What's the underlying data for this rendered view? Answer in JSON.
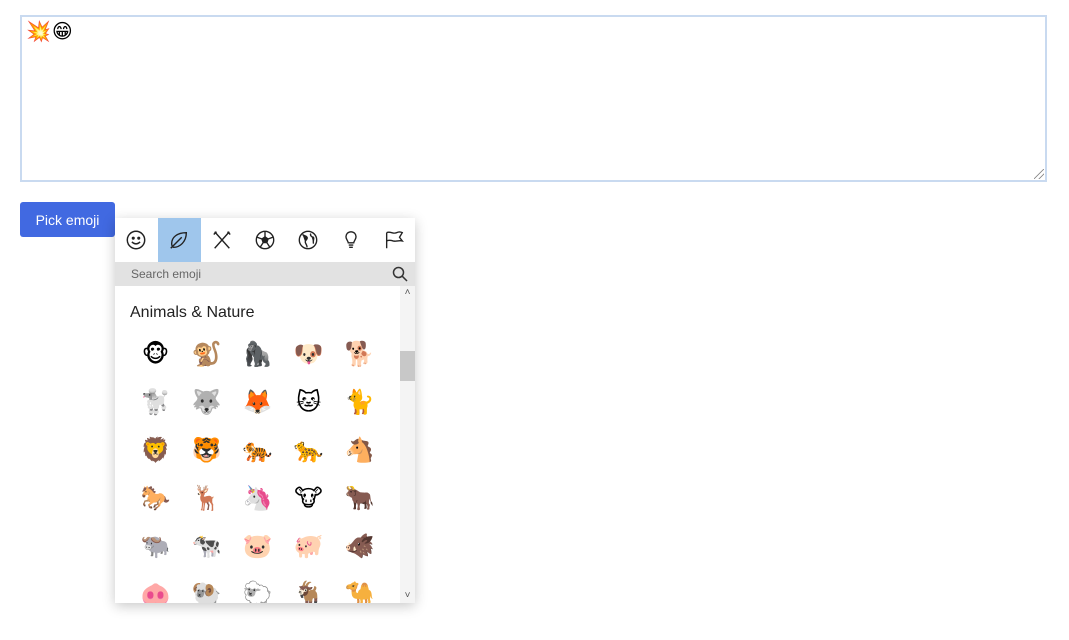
{
  "editor": {
    "content": "💥😁"
  },
  "button": {
    "pick_label": "Pick emoji"
  },
  "picker": {
    "tabs": [
      {
        "icon": "smiley-icon",
        "active": false
      },
      {
        "icon": "leaf-icon",
        "active": true
      },
      {
        "icon": "utensils-icon",
        "active": false
      },
      {
        "icon": "soccer-ball-icon",
        "active": false
      },
      {
        "icon": "globe-icon",
        "active": false
      },
      {
        "icon": "lightbulb-icon",
        "active": false
      },
      {
        "icon": "flag-icon",
        "active": false
      }
    ],
    "search": {
      "placeholder": "Search emoji"
    },
    "category": {
      "title": "Animals & Nature"
    },
    "emojis": [
      "🐵",
      "🐒",
      "🦍",
      "🐶",
      "🐕",
      "🐩",
      "🐺",
      "🦊",
      "🐱",
      "🐈",
      "🦁",
      "🐯",
      "🐅",
      "🐆",
      "🐴",
      "🐎",
      "🦌",
      "🦄",
      "🐮",
      "🐂",
      "🐃",
      "🐄",
      "🐷",
      "🐖",
      "🐗",
      "🐽",
      "🐏",
      "🐑",
      "🐐",
      "🐪"
    ]
  },
  "colors": {
    "accent": "#4169e1",
    "active_tab": "#9fc6ec",
    "search_bg": "#e2e2e2"
  }
}
